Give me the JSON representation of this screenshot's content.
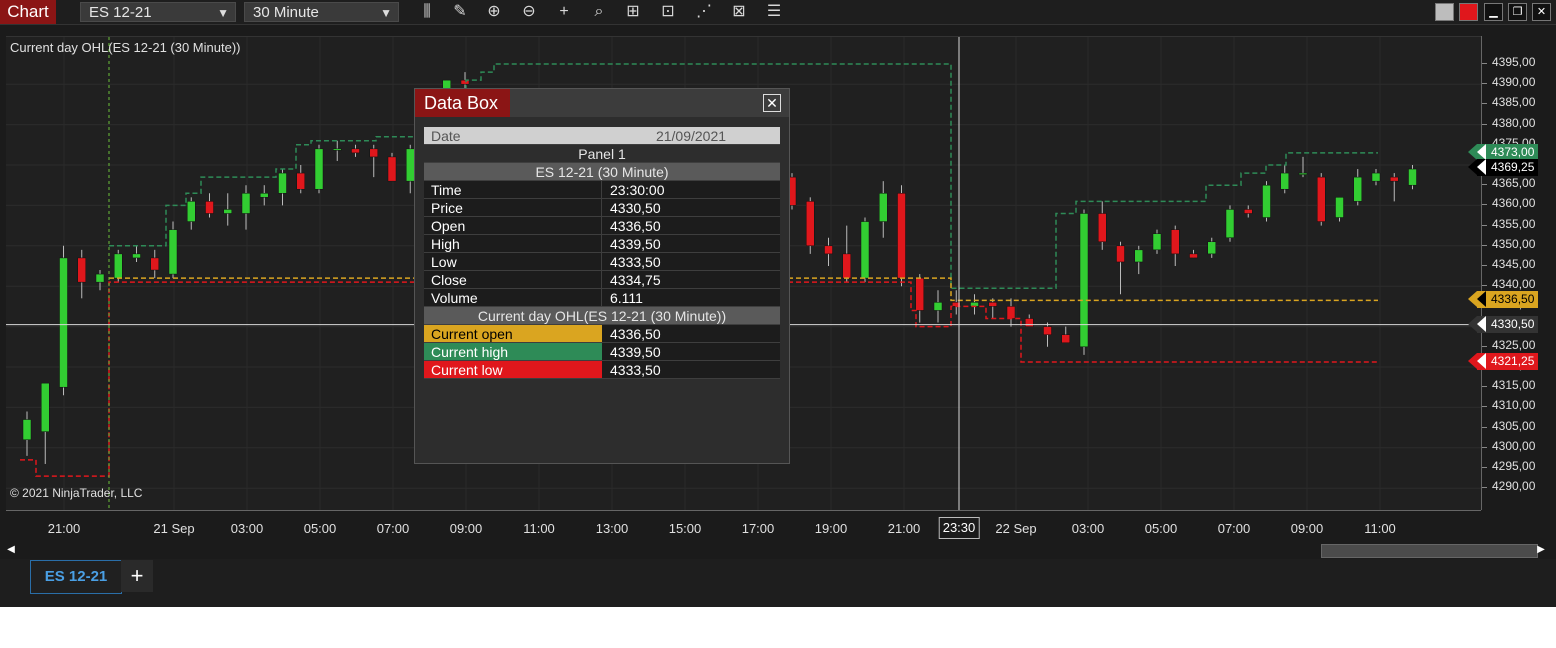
{
  "toolbar": {
    "chart_label": "Chart",
    "instrument": "ES 12-21",
    "interval": "30 Minute",
    "tools": [
      {
        "name": "bar-type-icon",
        "glyph": "⫼"
      },
      {
        "name": "drawing-tool-icon",
        "glyph": "✎"
      },
      {
        "name": "zoom-in-icon",
        "glyph": "⊕"
      },
      {
        "name": "zoom-out-icon",
        "glyph": "⊖"
      },
      {
        "name": "crosshair-icon",
        "glyph": "+"
      },
      {
        "name": "indicators-icon",
        "glyph": "⌕"
      },
      {
        "name": "chart-properties-icon",
        "glyph": "⊞"
      },
      {
        "name": "strategies-icon",
        "glyph": "⊡"
      },
      {
        "name": "chart-trader-icon",
        "glyph": "⋰"
      },
      {
        "name": "templates-icon",
        "glyph": "⊠"
      },
      {
        "name": "list-icon",
        "glyph": "☰"
      }
    ],
    "window_buttons": [
      {
        "name": "color-gray-button",
        "color": "#bdbdbd"
      },
      {
        "name": "color-red-button",
        "color": "#e0171c"
      },
      {
        "name": "minimize-button",
        "glyph": "▁"
      },
      {
        "name": "maximize-button",
        "glyph": "❐"
      },
      {
        "name": "close-button",
        "glyph": "✕"
      }
    ]
  },
  "chart": {
    "indicator_label": "Current day OHL(ES 12-21 (30 Minute))",
    "copyright": "© 2021 NinjaTrader, LLC",
    "y_ticks": [
      "4395,00",
      "4390,00",
      "4385,00",
      "4380,00",
      "4375,00",
      "4370,00",
      "4365,00",
      "4360,00",
      "4355,00",
      "4350,00",
      "4345,00",
      "4340,00",
      "4335,00",
      "4330,00",
      "4325,00",
      "4320,00",
      "4315,00",
      "4310,00",
      "4305,00",
      "4300,00",
      "4295,00",
      "4290,00"
    ],
    "x_ticks": [
      "21:00",
      "21 Sep",
      "03:00",
      "05:00",
      "07:00",
      "09:00",
      "11:00",
      "13:00",
      "15:00",
      "17:00",
      "19:00",
      "21:00",
      "22 Sep",
      "03:00",
      "05:00",
      "07:00",
      "09:00",
      "11:00"
    ],
    "cursor_time": "23:30",
    "price_markers": [
      {
        "label": "4373,00",
        "bg": "#2e8b57",
        "fg": "#ffffff"
      },
      {
        "label": "4369,25",
        "bg": "#000000",
        "fg": "#ffffff"
      },
      {
        "label": "4336,50",
        "bg": "#daa520",
        "fg": "#000000"
      },
      {
        "label": "4330,50",
        "bg": "#333333",
        "fg": "#ffffff"
      },
      {
        "label": "4321,25",
        "bg": "#e0171c",
        "fg": "#ffffff"
      }
    ],
    "colors": {
      "up": "#32cd32",
      "down": "#e0171c",
      "open": "#daa520",
      "high": "#2e8b57",
      "low": "#e0171c"
    }
  },
  "chart_data": {
    "type": "candlestick",
    "y_unit": "price",
    "ylim": [
      4287.5,
      4398.0
    ],
    "grid": true,
    "candles": [
      {
        "o": 4302,
        "h": 4309,
        "l": 4298,
        "c": 4307
      },
      {
        "o": 4304,
        "h": 4315,
        "l": 4296,
        "c": 4316
      },
      {
        "o": 4315,
        "h": 4350,
        "l": 4313,
        "c": 4347
      },
      {
        "o": 4347,
        "h": 4349,
        "l": 4337,
        "c": 4341
      },
      {
        "o": 4341,
        "h": 4344,
        "l": 4339,
        "c": 4343
      },
      {
        "o": 4342,
        "h": 4349,
        "l": 4341,
        "c": 4348
      },
      {
        "o": 4347,
        "h": 4350,
        "l": 4346,
        "c": 4348
      },
      {
        "o": 4347,
        "h": 4349,
        "l": 4342,
        "c": 4344
      },
      {
        "o": 4343,
        "h": 4356,
        "l": 4342,
        "c": 4354
      },
      {
        "o": 4356,
        "h": 4362,
        "l": 4354,
        "c": 4361
      },
      {
        "o": 4361,
        "h": 4363,
        "l": 4357,
        "c": 4358
      },
      {
        "o": 4358,
        "h": 4363,
        "l": 4355,
        "c": 4359
      },
      {
        "o": 4358,
        "h": 4365,
        "l": 4354,
        "c": 4363
      },
      {
        "o": 4362,
        "h": 4365,
        "l": 4360,
        "c": 4363
      },
      {
        "o": 4363,
        "h": 4369,
        "l": 4360,
        "c": 4368
      },
      {
        "o": 4368,
        "h": 4370,
        "l": 4363,
        "c": 4364
      },
      {
        "o": 4364,
        "h": 4375,
        "l": 4363,
        "c": 4374
      },
      {
        "o": 4374,
        "h": 4376,
        "l": 4371,
        "c": 4374
      },
      {
        "o": 4374,
        "h": 4375,
        "l": 4372,
        "c": 4373
      },
      {
        "o": 4374,
        "h": 4375,
        "l": 4367,
        "c": 4372
      },
      {
        "o": 4372,
        "h": 4373,
        "l": 4366,
        "c": 4366
      },
      {
        "o": 4366,
        "h": 4375,
        "l": 4363,
        "c": 4374
      },
      {
        "o": 4383,
        "h": 4389,
        "l": 4379,
        "c": 4388
      },
      {
        "o": 4388,
        "h": 4391,
        "l": 4386,
        "c": 4391
      },
      {
        "o": 4391,
        "h": 4393,
        "l": 4388,
        "c": 4390
      },
      {
        "o": 4367,
        "h": 4368,
        "l": 4359,
        "c": 4360
      },
      {
        "o": 4361,
        "h": 4362,
        "l": 4348,
        "c": 4350
      },
      {
        "o": 4350,
        "h": 4352,
        "l": 4345,
        "c": 4348
      },
      {
        "o": 4348,
        "h": 4355,
        "l": 4341,
        "c": 4342
      },
      {
        "o": 4342,
        "h": 4357,
        "l": 4341,
        "c": 4356
      },
      {
        "o": 4356,
        "h": 4366,
        "l": 4352,
        "c": 4363
      },
      {
        "o": 4363,
        "h": 4365,
        "l": 4340,
        "c": 4342
      },
      {
        "o": 4342,
        "h": 4343,
        "l": 4331,
        "c": 4334
      },
      {
        "o": 4334,
        "h": 4339,
        "l": 4331,
        "c": 4336
      },
      {
        "o": 4336,
        "h": 4339,
        "l": 4333,
        "c": 4335
      },
      {
        "o": 4335,
        "h": 4338,
        "l": 4333,
        "c": 4336
      },
      {
        "o": 4336,
        "h": 4337,
        "l": 4332,
        "c": 4335
      },
      {
        "o": 4335,
        "h": 4337,
        "l": 4330,
        "c": 4332
      },
      {
        "o": 4332,
        "h": 4333,
        "l": 4330,
        "c": 4330
      },
      {
        "o": 4330,
        "h": 4331,
        "l": 4325,
        "c": 4328
      },
      {
        "o": 4328,
        "h": 4330,
        "l": 4326,
        "c": 4326
      },
      {
        "o": 4325,
        "h": 4359,
        "l": 4323,
        "c": 4358
      },
      {
        "o": 4358,
        "h": 4361,
        "l": 4349,
        "c": 4351
      },
      {
        "o": 4350,
        "h": 4351,
        "l": 4338,
        "c": 4346
      },
      {
        "o": 4346,
        "h": 4350,
        "l": 4343,
        "c": 4349
      },
      {
        "o": 4349,
        "h": 4354,
        "l": 4348,
        "c": 4353
      },
      {
        "o": 4354,
        "h": 4355,
        "l": 4345,
        "c": 4348
      },
      {
        "o": 4348,
        "h": 4349,
        "l": 4347,
        "c": 4347
      },
      {
        "o": 4348,
        "h": 4352,
        "l": 4347,
        "c": 4351
      },
      {
        "o": 4352,
        "h": 4360,
        "l": 4351,
        "c": 4359
      },
      {
        "o": 4359,
        "h": 4360,
        "l": 4357,
        "c": 4358
      },
      {
        "o": 4357,
        "h": 4366,
        "l": 4356,
        "c": 4365
      },
      {
        "o": 4364,
        "h": 4370,
        "l": 4363,
        "c": 4368
      },
      {
        "o": 4368,
        "h": 4372,
        "l": 4367,
        "c": 4368
      },
      {
        "o": 4367,
        "h": 4368,
        "l": 4355,
        "c": 4356
      },
      {
        "o": 4357,
        "h": 4362,
        "l": 4356,
        "c": 4362
      },
      {
        "o": 4361,
        "h": 4369,
        "l": 4360,
        "c": 4367
      },
      {
        "o": 4366,
        "h": 4369,
        "l": 4365,
        "c": 4368
      },
      {
        "o": 4367,
        "h": 4368,
        "l": 4361,
        "c": 4366
      },
      {
        "o": 4365,
        "h": 4370,
        "l": 4364,
        "c": 4369
      }
    ],
    "current_day_open": 4336.5,
    "current_day_high": 4339.5,
    "current_day_low": 4333.5,
    "crosshair_price": 4330.5
  },
  "databox": {
    "title": "Data Box",
    "date_label": "Date",
    "date_value": "21/09/2021",
    "panel_label": "Panel 1",
    "series_header": "ES 12-21 (30 Minute)",
    "fields": [
      {
        "label": "Time",
        "value": "23:30:00"
      },
      {
        "label": "Price",
        "value": "4330,50"
      },
      {
        "label": "Open",
        "value": "4336,50"
      },
      {
        "label": "High",
        "value": "4339,50"
      },
      {
        "label": "Low",
        "value": "4333,50"
      },
      {
        "label": "Close",
        "value": "4334,75"
      },
      {
        "label": "Volume",
        "value": "6.111"
      }
    ],
    "indicator_header": "Current day OHL(ES 12-21 (30 Minute))",
    "indicator_fields": [
      {
        "label": "Current open",
        "value": "4336,50",
        "color": "#daa520"
      },
      {
        "label": "Current high",
        "value": "4339,50",
        "color": "#2e8b57"
      },
      {
        "label": "Current low",
        "value": "4333,50",
        "color": "#e0171c"
      }
    ]
  },
  "tabs": {
    "active": "ES 12-21",
    "add": "+"
  }
}
